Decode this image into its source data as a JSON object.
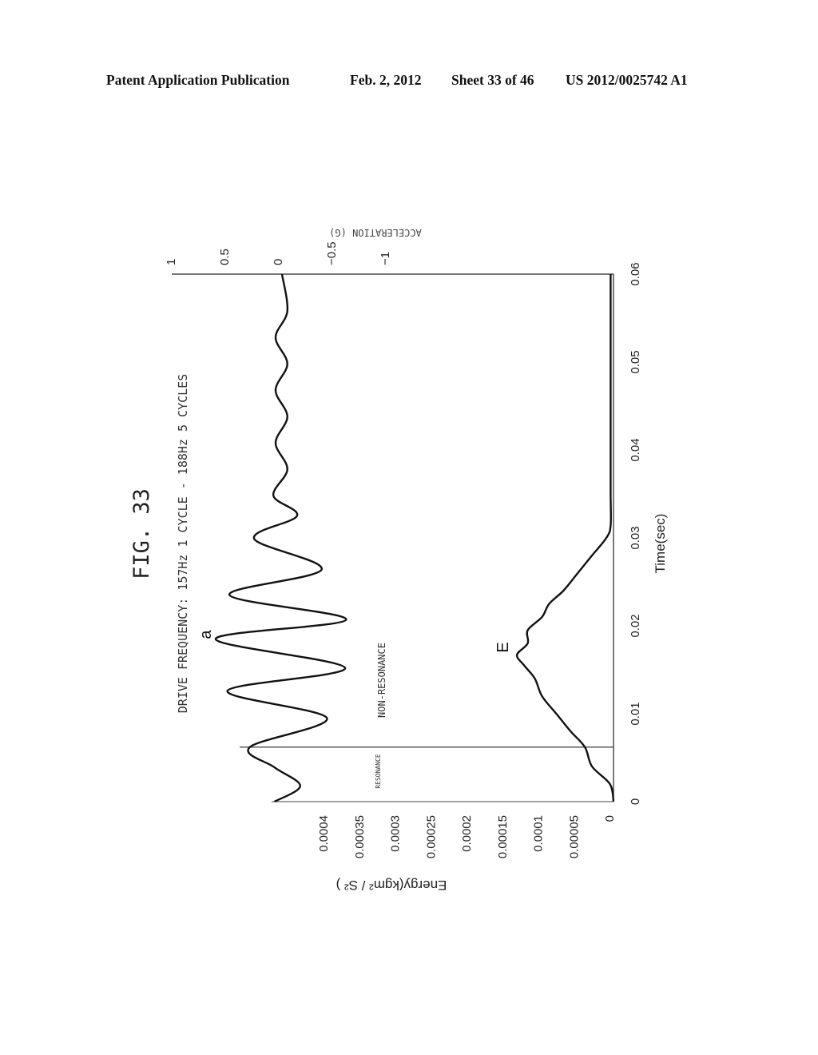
{
  "header": {
    "publication": "Patent Application Publication",
    "date": "Feb. 2, 2012",
    "sheet": "Sheet 33 of 46",
    "number": "US 2012/0025742 A1"
  },
  "figure": {
    "label": "FIG. 33",
    "subtitle": "DRIVE FREQUENCY: 157Hz 1 CYCLE - 188Hz 5 CYCLES",
    "orientation": "rotated 90 degrees clockwise",
    "region_labels": {
      "resonance": "RESONANCE",
      "non_resonance": "NON-RESONANCE"
    },
    "curve_labels": {
      "acceleration": "a",
      "energy": "E"
    }
  },
  "chart_data": {
    "type": "line",
    "title": "FIG. 33",
    "subtitle": "DRIVE FREQUENCY: 157Hz 1 CYCLE - 188Hz 5 CYCLES",
    "xlabel": "Time(sec)",
    "x_ticks": [
      "0",
      "0.01",
      "0.02",
      "0.03",
      "0.04",
      "0.05",
      "0.06"
    ],
    "xlim": [
      0,
      0.06
    ],
    "y_axes": [
      {
        "name": "energy",
        "label": "Energy(kgm² / S² )",
        "ylim": [
          0,
          0.0004
        ],
        "ticks": [
          "0",
          "0.00005",
          "0.0001",
          "0.00015",
          "0.0002",
          "0.00025",
          "0.0003",
          "0.00035",
          "0.0004"
        ]
      },
      {
        "name": "acceleration",
        "label": "ACCELERATION (G)",
        "ylim": [
          -1,
          1
        ],
        "ticks": [
          "1",
          "0.5",
          "0",
          "-0.5",
          "-1"
        ]
      }
    ],
    "resonance_boundary_time": 0.0062,
    "series": [
      {
        "name": "a",
        "axis": "acceleration",
        "x": [
          0,
          0.0018,
          0.0039,
          0.0062,
          0.0095,
          0.0126,
          0.0152,
          0.0185,
          0.0207,
          0.0235,
          0.0264,
          0.0299,
          0.0325,
          0.0348,
          0.0378,
          0.0408,
          0.0438,
          0.0468,
          0.0498,
          0.0528,
          0.0558,
          0.06
        ],
        "y": [
          0.07,
          -0.17,
          0.07,
          0.3,
          -0.42,
          0.51,
          -0.59,
          0.62,
          -0.6,
          0.49,
          -0.37,
          0.26,
          -0.14,
          0.08,
          -0.05,
          0.06,
          -0.05,
          0.06,
          -0.05,
          0.06,
          -0.05,
          0.0
        ]
      },
      {
        "name": "E",
        "axis": "energy",
        "x": [
          0,
          0.002,
          0.004,
          0.0062,
          0.008,
          0.01,
          0.012,
          0.014,
          0.0155,
          0.0167,
          0.018,
          0.0195,
          0.021,
          0.0225,
          0.024,
          0.026,
          0.028,
          0.03,
          0.0314,
          0.035,
          0.04,
          0.05,
          0.06
        ],
        "y": [
          0.0,
          5e-06,
          3e-05,
          4e-05,
          6e-05,
          8e-05,
          0.0001,
          0.00011,
          0.000125,
          0.000135,
          0.00012,
          0.00012,
          0.0001,
          9e-05,
          7e-05,
          5e-05,
          3e-05,
          1e-05,
          4e-06,
          4e-06,
          4e-06,
          4e-06,
          4e-06
        ]
      }
    ],
    "grid": false
  }
}
